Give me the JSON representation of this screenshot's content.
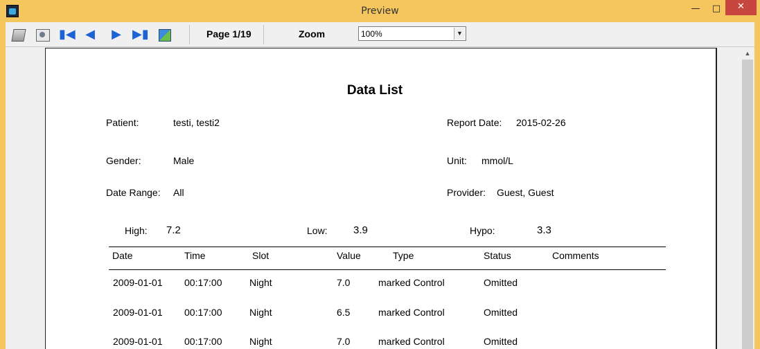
{
  "window": {
    "title": "Preview"
  },
  "toolbar": {
    "page_label": "Page 1/19",
    "zoom_label": "Zoom",
    "zoom_value": "100%"
  },
  "report": {
    "title": "Data List",
    "patient_label": "Patient:",
    "patient_value": "testi, testi2",
    "report_date_label": "Report Date:",
    "report_date_value": "2015-02-26",
    "gender_label": "Gender:",
    "gender_value": "Male",
    "unit_label": "Unit:",
    "unit_value": "mmol/L",
    "date_range_label": "Date Range:",
    "date_range_value": "All",
    "provider_label": "Provider:",
    "provider_value": "Guest, Guest",
    "high_label": "High:",
    "high_value": "7.2",
    "low_label": "Low:",
    "low_value": "3.9",
    "hypo_label": "Hypo:",
    "hypo_value": "3.3"
  },
  "table": {
    "headers": [
      "Date",
      "Time",
      "Slot",
      "Value",
      "Type",
      "Status",
      "Comments"
    ],
    "rows": [
      [
        "2009-01-01",
        "00:17:00",
        "Night",
        "7.0",
        "marked Control",
        "Omitted",
        ""
      ],
      [
        "2009-01-01",
        "00:17:00",
        "Night",
        "6.5",
        "marked Control",
        "Omitted",
        ""
      ],
      [
        "2009-01-01",
        "00:17:00",
        "Night",
        "7.0",
        "marked Control",
        "Omitted",
        ""
      ]
    ]
  }
}
